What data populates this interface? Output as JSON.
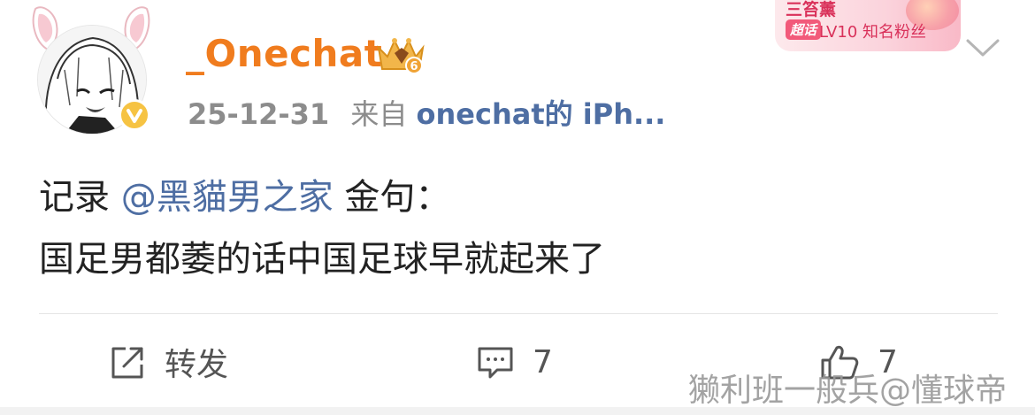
{
  "post": {
    "user": {
      "name": "_Onechat",
      "crown_level": "6",
      "avatar_icon": "anime-girl-avatar",
      "verified_icon": "verified-badge-icon",
      "verified_color": "#f6c343",
      "name_color": "#f07c1e"
    },
    "meta": {
      "date": "25-12-31",
      "from_label": "来自",
      "source": "onechat的 iPh..."
    },
    "fan_badge": {
      "name": "三笞薰",
      "tag": "超话",
      "level": "LV10 知名粉丝"
    },
    "content": {
      "line1_prefix": "记录 ",
      "mention": "@黑貓男之家",
      "line1_suffix": " 金句：",
      "line2": "国足男都萎的话中国足球早就起来了"
    },
    "actions": {
      "repost_label": "转发",
      "comment_count": "7",
      "like_count": "7"
    },
    "watermark": "獭利班一般兵@懂球帝",
    "colors": {
      "link": "#4e6ea3",
      "meta": "#8c8c8c",
      "text": "#222222"
    }
  }
}
